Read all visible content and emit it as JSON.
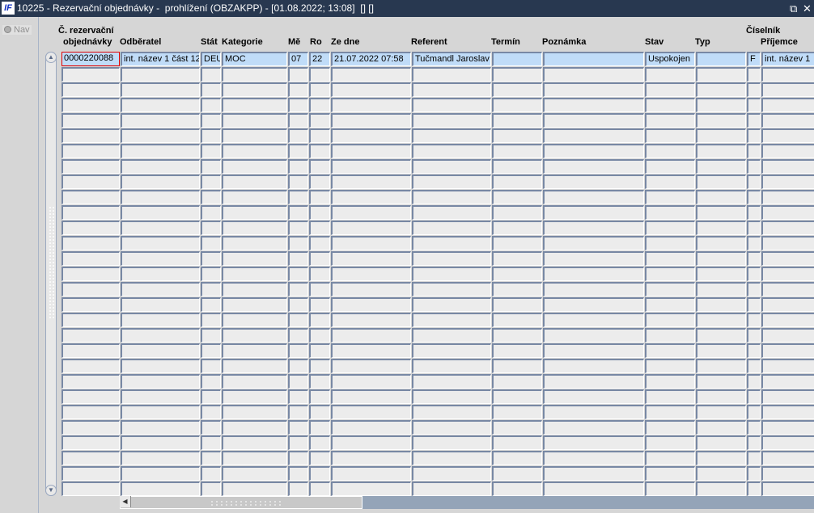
{
  "window": {
    "logo": "IF",
    "title": "10225 - Rezervační objednávky -  prohlížení (OBZAKPP) - [01.08.2022; 13:08]  [] []",
    "restore_icon": "restore-icon",
    "close_icon": "close-icon"
  },
  "nav": {
    "label": "Nav"
  },
  "headers": {
    "c0a": "Č. rezervační",
    "c0b": "objednávky",
    "c1": "Odběratel",
    "c2": "Stát",
    "c3": "Kategorie",
    "c4": "Mě",
    "c5": "Ro",
    "c6": "Ze dne",
    "c7": "Referent",
    "c8": "Termín",
    "c9": "Poznámka",
    "c10": "Stav",
    "c11": "Typ",
    "c12a": "Číselník",
    "c12b": "Příjemce"
  },
  "rows": [
    [
      "0000220088",
      "int. název 1 část 12",
      "DEU",
      "MOC",
      "07",
      "22",
      "21.07.2022 07:58",
      "Tučmandl Jaroslav",
      "",
      "",
      "Uspokojen",
      "",
      "F",
      "int. název 1"
    ]
  ],
  "empty_row_count": 28
}
